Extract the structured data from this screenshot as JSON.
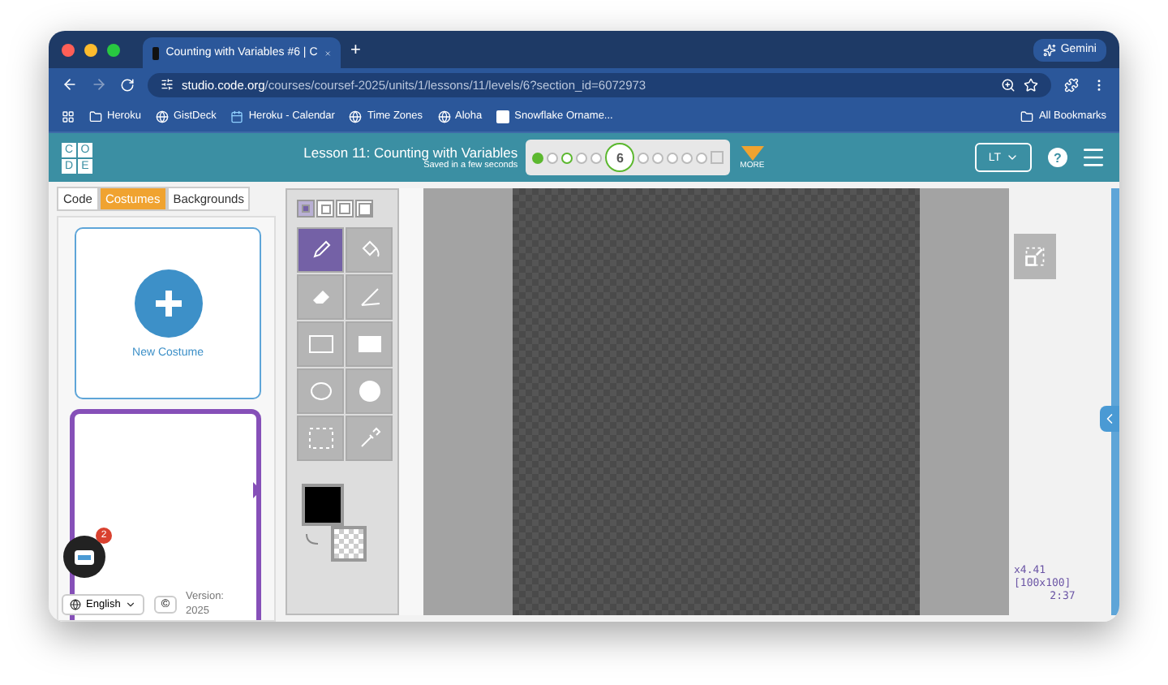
{
  "browser": {
    "tab_title": "Counting with Variables #6 | C",
    "new_tab": "+",
    "profile_button": "Gemini",
    "url_host": "studio.code.org",
    "url_path": "/courses/coursef-2025/units/1/lessons/11/levels/6?section_id=6072973"
  },
  "bookmarks": [
    {
      "label": "Heroku",
      "kind": "folder"
    },
    {
      "label": "GistDeck",
      "kind": "globe"
    },
    {
      "label": "Heroku - Calendar",
      "kind": "calendar"
    },
    {
      "label": "Time Zones",
      "kind": "globe"
    },
    {
      "label": "Aloha",
      "kind": "globe"
    },
    {
      "label": "Snowflake Orname...",
      "kind": "app"
    }
  ],
  "all_bookmarks": "All Bookmarks",
  "header": {
    "lesson_title": "Lesson 11: Counting with Variables",
    "save_status": "Saved in a few seconds",
    "more": "MORE",
    "language_button": "LT",
    "help": "?"
  },
  "logo_letters": [
    "C",
    "O",
    "D",
    "E"
  ],
  "progress": [
    {
      "kind": "dot",
      "complete": true,
      "attempted": true
    },
    {
      "kind": "dot",
      "complete": false,
      "attempted": false
    },
    {
      "kind": "dot",
      "complete": false,
      "attempted": true
    },
    {
      "kind": "dot",
      "complete": false,
      "attempted": false
    },
    {
      "kind": "dot",
      "complete": false,
      "attempted": false
    },
    {
      "kind": "current",
      "complete": false,
      "attempted": true,
      "label": "6"
    },
    {
      "kind": "dot",
      "complete": false,
      "attempted": false
    },
    {
      "kind": "dot",
      "complete": false,
      "attempted": false
    },
    {
      "kind": "dot",
      "complete": false,
      "attempted": false
    },
    {
      "kind": "dot",
      "complete": false,
      "attempted": false
    },
    {
      "kind": "dot",
      "complete": false,
      "attempted": false
    },
    {
      "kind": "flag",
      "complete": false,
      "attempted": false
    }
  ],
  "tabs": [
    {
      "label": "Code",
      "selected": false
    },
    {
      "label": "Costumes",
      "selected": true
    },
    {
      "label": "Backgrounds",
      "selected": false
    }
  ],
  "new_costume": "New Costume",
  "costumes": [
    {
      "selected": true
    }
  ],
  "footer": {
    "badge": "2",
    "language": "English",
    "copyright": "©",
    "version": "Version: 2025"
  },
  "brush_sizes": [
    {
      "selected": true
    },
    {
      "selected": false
    },
    {
      "selected": false
    },
    {
      "selected": false
    }
  ],
  "tools": [
    {
      "kind": "pencil",
      "selected": true
    },
    {
      "kind": "fill",
      "selected": false
    },
    {
      "kind": "eraser",
      "selected": false
    },
    {
      "kind": "line",
      "selected": false
    },
    {
      "kind": "rect",
      "selected": false
    },
    {
      "kind": "rect-filled",
      "selected": false
    },
    {
      "kind": "ellipse",
      "selected": false
    },
    {
      "kind": "ellipse-filled",
      "selected": false
    },
    {
      "kind": "select",
      "selected": false
    },
    {
      "kind": "picker",
      "selected": false
    }
  ],
  "stage_info": [
    "x4.41",
    "[100x100]",
    "2:37"
  ]
}
